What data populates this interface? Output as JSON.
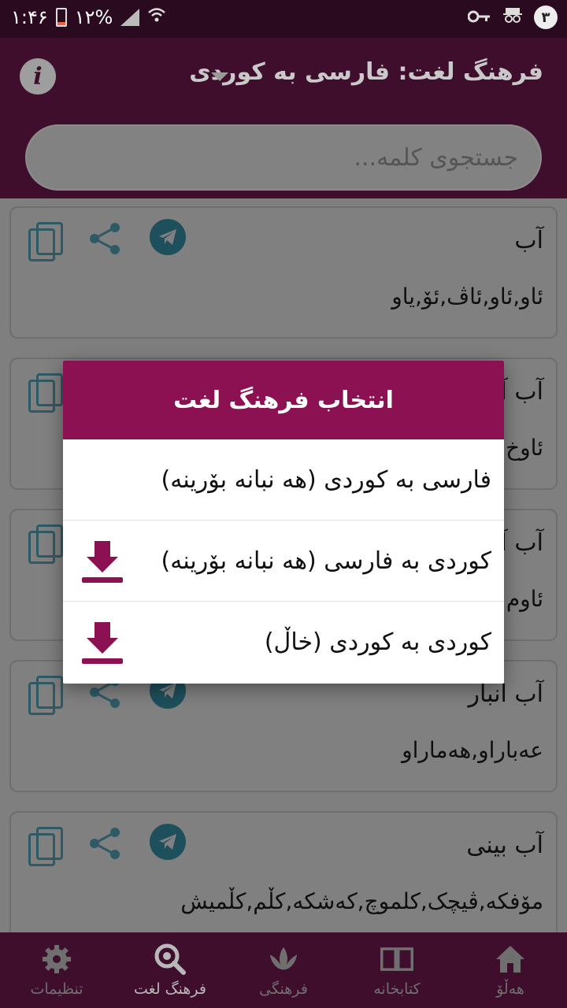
{
  "status_bar": {
    "time": "۱:۴۶",
    "battery": "۱۲%",
    "notification_count": "۳"
  },
  "app_bar": {
    "title": "فرهنگ لغت: فارسی به کوردی"
  },
  "search": {
    "placeholder": "جستجوی کلمه..."
  },
  "entries": [
    {
      "word": "آب",
      "meaning": "ئاو,ئاو,ئاڤ,ئۆ,یاو"
    },
    {
      "word": "آب آ",
      "meaning": "ئاوخ"
    },
    {
      "word": "آب آ",
      "meaning": "ئاوم"
    },
    {
      "word": "آب انبار",
      "meaning": "عەباراو,هەماراو"
    },
    {
      "word": "آب بینی",
      "meaning": "مۆفکە,ڤیچک,کلموچ,کەشکە,کڵم,کڵمیش"
    }
  ],
  "dialog": {
    "title": "انتخاب فرهنگ لغت",
    "options": [
      {
        "label": "فارسی به کوردی (هه نبانه بۆرینه)",
        "downloadable": false
      },
      {
        "label": "کوردی به فارسی (هه نبانه بۆرینه)",
        "downloadable": true
      },
      {
        "label": "کوردی به کوردی (خاڵ)",
        "downloadable": true
      }
    ]
  },
  "bottom_nav": [
    {
      "label": "تنظیمات",
      "icon": "gear-icon"
    },
    {
      "label": "فرهنگ لغت",
      "icon": "dictionary-search-icon"
    },
    {
      "label": "فرهنگی",
      "icon": "lotus-icon"
    },
    {
      "label": "کتابخانه",
      "icon": "book-icon"
    },
    {
      "label": "هەڵۆ",
      "icon": "home-icon"
    }
  ],
  "colors": {
    "primary": "#8b1152",
    "primary_dark": "#3f0e2d",
    "accent_icon": "#2e5a66",
    "download_icon": "#8b1152"
  }
}
